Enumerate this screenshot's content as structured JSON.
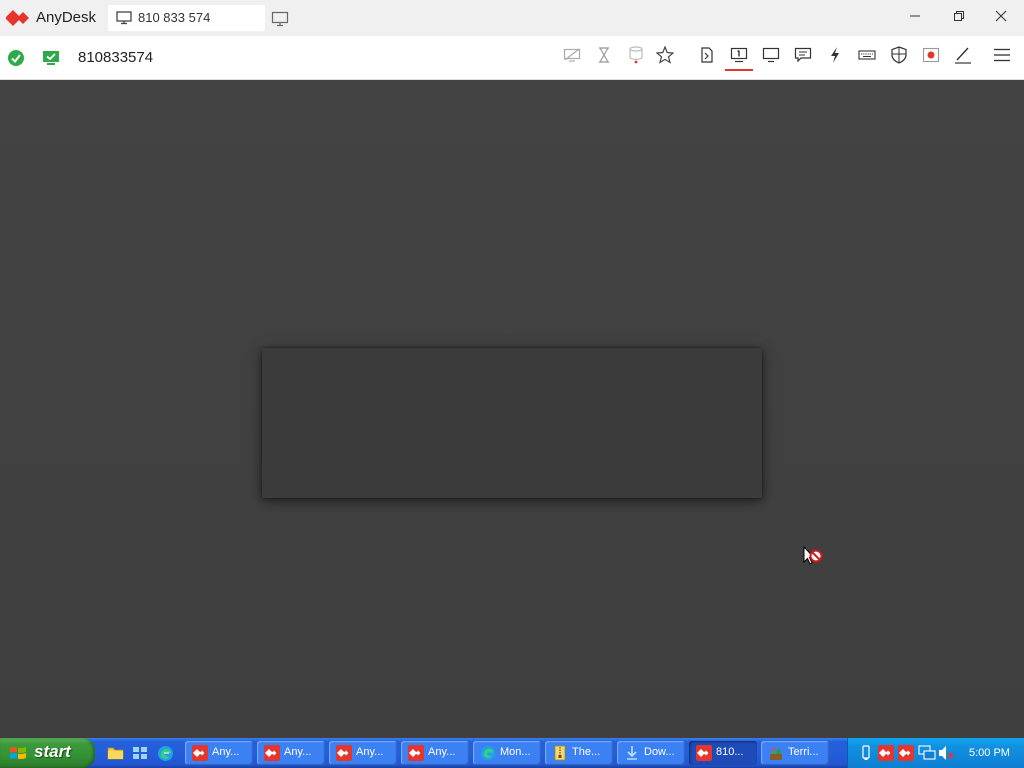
{
  "app": {
    "title": "AnyDesk",
    "tab_label": "810 833 574",
    "accent_color": "#e5352c"
  },
  "titlebar_icons": [
    "anydesk-logo-icon",
    "monitor-icon",
    "new-session-icon",
    "minimize-icon",
    "restore-icon",
    "close-icon"
  ],
  "toolbar": {
    "session_id": "810833574",
    "left_icons": [
      "connection-ok-icon",
      "remote-screen-icon"
    ],
    "right_icons": [
      "display-hidden-icon",
      "hourglass-icon",
      "disk-icon",
      "favorite-star-icon",
      "file-transfer-icon",
      "monitor-select-icon",
      "display-icon",
      "chat-icon",
      "actions-lightning-icon",
      "keyboard-icon",
      "permissions-shield-icon",
      "record-icon",
      "whiteboard-pen-icon",
      "menu-icon"
    ]
  },
  "remote_cursor": "no-access-cursor-icon",
  "taskbar": {
    "start_label": "start",
    "quicklaunch_icons": [
      "explorer-icon",
      "apps-icon",
      "edge-icon"
    ],
    "tasks": [
      {
        "label": "Any...",
        "icon": "anydesk-icon",
        "active": false
      },
      {
        "label": "Any...",
        "icon": "anydesk-icon",
        "active": false
      },
      {
        "label": "Any...",
        "icon": "anydesk-icon",
        "active": false
      },
      {
        "label": "Any...",
        "icon": "anydesk-icon",
        "active": false
      },
      {
        "label": "Mon...",
        "icon": "edge-icon",
        "active": false
      },
      {
        "label": "The...",
        "icon": "archive-icon",
        "active": false
      },
      {
        "label": "Dow...",
        "icon": "download-icon",
        "active": false
      },
      {
        "label": "810...",
        "icon": "anydesk-icon",
        "active": true
      },
      {
        "label": "Terri...",
        "icon": "terrarium-icon",
        "active": false
      }
    ],
    "tray_icons": [
      "usb-icon",
      "anydesk-tray-icon",
      "anydesk-tray-icon",
      "network-icon",
      "volume-muted-icon"
    ],
    "clock": "5:00 PM"
  }
}
